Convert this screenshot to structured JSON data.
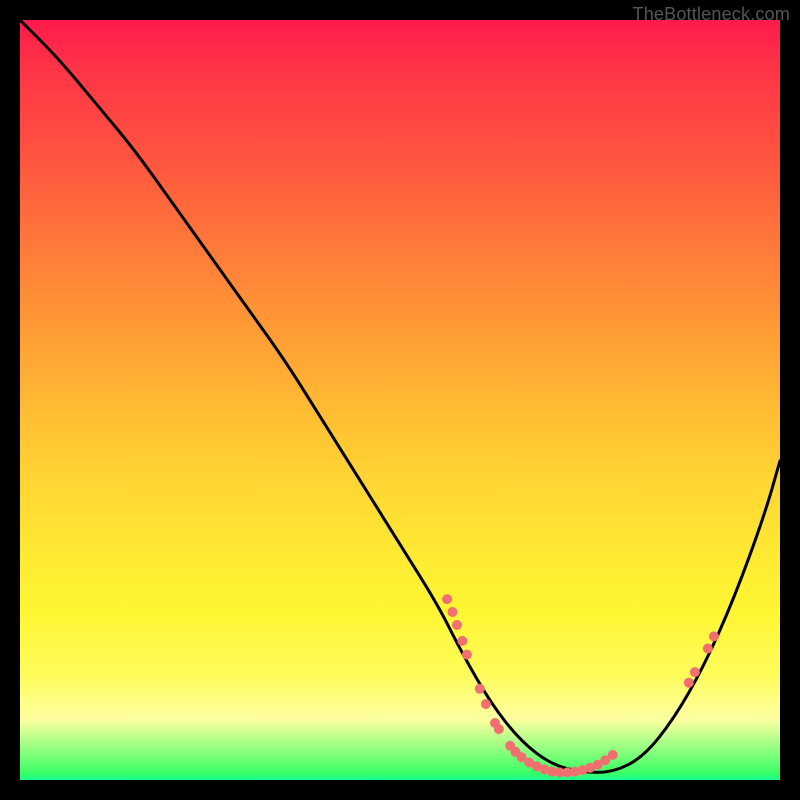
{
  "watermark": "TheBottleneck.com",
  "chart_data": {
    "type": "line",
    "title": "",
    "xlabel": "",
    "ylabel": "",
    "xlim": [
      0,
      100
    ],
    "ylim": [
      0,
      100
    ],
    "series": [
      {
        "name": "curve",
        "x": [
          0,
          5,
          10,
          15,
          20,
          25,
          30,
          35,
          40,
          45,
          50,
          55,
          58,
          62,
          66,
          70,
          74,
          78,
          82,
          86,
          90,
          94,
          98,
          100
        ],
        "y": [
          100,
          95,
          89,
          83,
          76,
          69,
          62,
          55,
          47,
          39,
          31,
          23,
          17,
          10,
          5,
          2,
          1,
          1,
          3,
          8,
          15,
          24,
          35,
          42
        ]
      }
    ],
    "markers": [
      {
        "x": 56.2,
        "y": 23.8
      },
      {
        "x": 56.9,
        "y": 22.1
      },
      {
        "x": 57.5,
        "y": 20.4
      },
      {
        "x": 58.2,
        "y": 18.3
      },
      {
        "x": 58.8,
        "y": 16.5
      },
      {
        "x": 60.5,
        "y": 12.0
      },
      {
        "x": 61.3,
        "y": 10.0
      },
      {
        "x": 62.5,
        "y": 7.5
      },
      {
        "x": 63.0,
        "y": 6.7
      },
      {
        "x": 64.5,
        "y": 4.5
      },
      {
        "x": 65.2,
        "y": 3.7
      },
      {
        "x": 66.0,
        "y": 3.0
      },
      {
        "x": 67.0,
        "y": 2.3
      },
      {
        "x": 68.0,
        "y": 1.8
      },
      {
        "x": 69.0,
        "y": 1.4
      },
      {
        "x": 70.0,
        "y": 1.1
      },
      {
        "x": 71.0,
        "y": 1.0
      },
      {
        "x": 72.0,
        "y": 1.0
      },
      {
        "x": 73.0,
        "y": 1.1
      },
      {
        "x": 74.0,
        "y": 1.3
      },
      {
        "x": 75.0,
        "y": 1.6
      },
      {
        "x": 76.0,
        "y": 2.0
      },
      {
        "x": 77.0,
        "y": 2.6
      },
      {
        "x": 78.0,
        "y": 3.3
      },
      {
        "x": 88.0,
        "y": 12.8
      },
      {
        "x": 88.8,
        "y": 14.2
      },
      {
        "x": 90.5,
        "y": 17.3
      },
      {
        "x": 91.3,
        "y": 18.9
      }
    ],
    "colors": {
      "curve": "#000000",
      "markers": "#f07070"
    }
  }
}
